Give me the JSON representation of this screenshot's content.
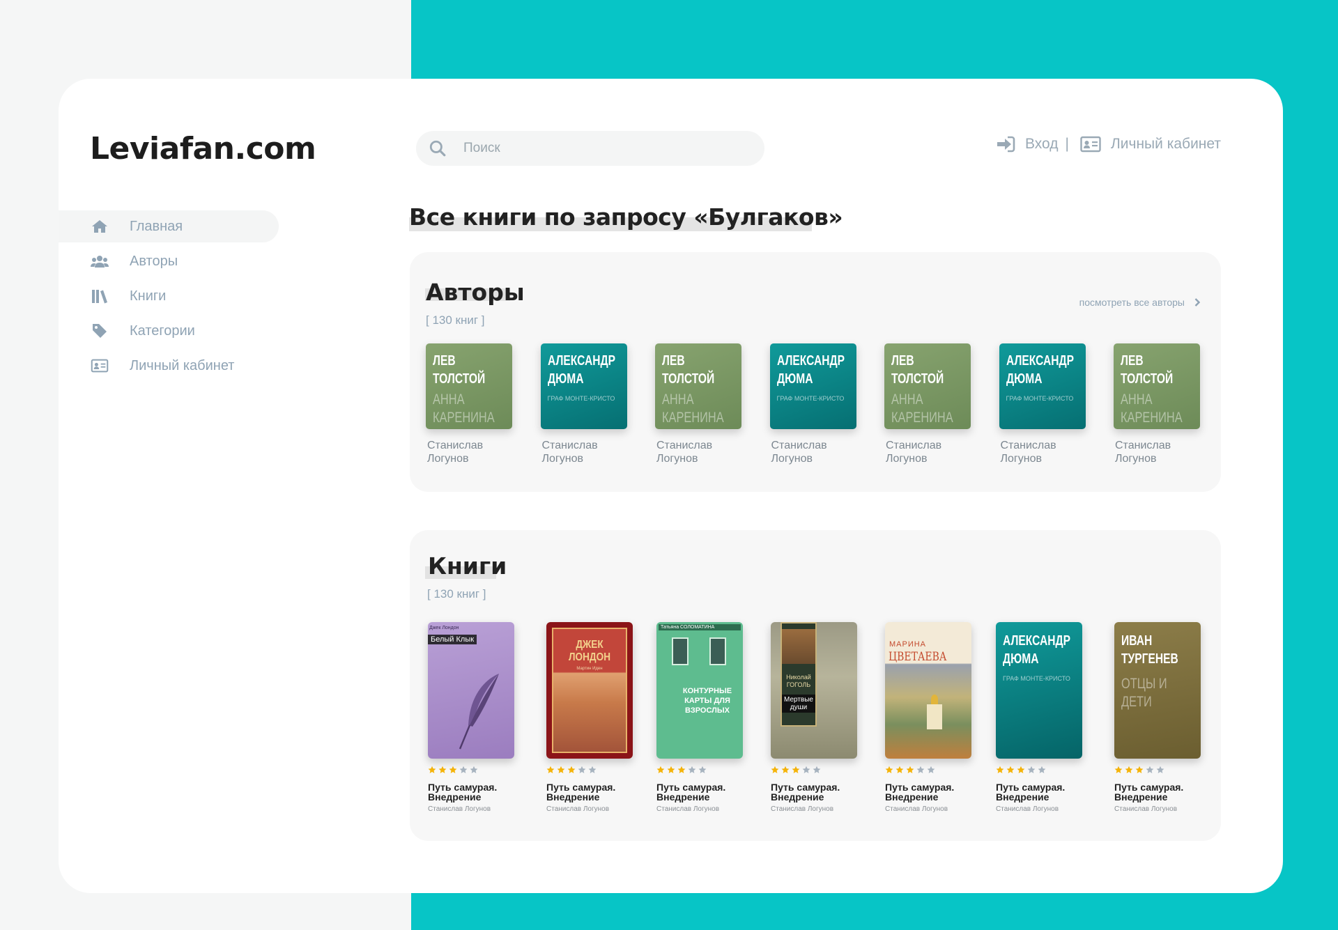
{
  "site": {
    "logo": "Leviafan.com"
  },
  "search": {
    "placeholder": "Поиск"
  },
  "topnav": {
    "login": "Вход",
    "separator": "|",
    "cabinet": "Личный кабинет"
  },
  "sidebar": {
    "items": [
      {
        "label": "Главная",
        "icon": "home-icon",
        "active": true
      },
      {
        "label": "Авторы",
        "icon": "users-icon"
      },
      {
        "label": "Книги",
        "icon": "books-icon"
      },
      {
        "label": "Категории",
        "icon": "tag-icon"
      },
      {
        "label": "Личный кабинет",
        "icon": "id-card-icon"
      }
    ]
  },
  "page": {
    "heading": "Все книги по запросу «Булгаков»"
  },
  "authors_section": {
    "title": "Авторы",
    "count": "[ 130 книг ]",
    "see_all": "посмотреть все авторы",
    "cards": [
      {
        "cover_author": "Лев Толстой",
        "cover_title": "Анна Каренина",
        "cover_sub": "",
        "color": "green",
        "name": "Станислав Логунов"
      },
      {
        "cover_author": "Александр Дюма",
        "cover_title": "",
        "cover_sub": "Граф Монте-Кристо",
        "color": "teal",
        "name": "Станислав Логунов"
      },
      {
        "cover_author": "Лев Толстой",
        "cover_title": "Анна Каренина",
        "cover_sub": "",
        "color": "green",
        "name": "Станислав Логунов"
      },
      {
        "cover_author": "Александр Дюма",
        "cover_title": "",
        "cover_sub": "Граф Монте-Кристо",
        "color": "teal",
        "name": "Станислав Логунов"
      },
      {
        "cover_author": "Лев Толстой",
        "cover_title": "Анна Каренина",
        "cover_sub": "",
        "color": "green",
        "name": "Станислав Логунов"
      },
      {
        "cover_author": "Александр Дюма",
        "cover_title": "",
        "cover_sub": "Граф Монте-Кристо",
        "color": "teal",
        "name": "Станислав Логунов"
      },
      {
        "cover_author": "Лев Толстой",
        "cover_title": "Анна Каренина",
        "cover_sub": "",
        "color": "green",
        "name": "Станислав Логунов"
      }
    ]
  },
  "books_section": {
    "title": "Книги",
    "count": "[ 130 книг ]",
    "cards": [
      {
        "cover_top": "Джек Лондон",
        "cover_label": "Белый Клык",
        "rating": 3,
        "title": "Путь самурая. Внедрение",
        "author": "Станислав Логунов"
      },
      {
        "cover_top": "ДЖЕК ЛОНДОН",
        "cover_label": "Мартин Иден",
        "rating": 3,
        "title": "Путь самурая. Внедрение",
        "author": "Станислав Логунов"
      },
      {
        "cover_top": "Татьяна СОЛОМАТИНА",
        "cover_label": "КОНТУРНЫЕ КАРТЫ ДЛЯ ВЗРОСЛЫХ",
        "rating": 3,
        "title": "Путь самурая. Внедрение",
        "author": "Станислав Логунов"
      },
      {
        "cover_top": "Николай ГОГОЛЬ",
        "cover_label": "Мертвые души",
        "rating": 3,
        "title": "Путь самурая. Внедрение",
        "author": "Станислав Логунов"
      },
      {
        "cover_top": "МАРИНА",
        "cover_label": "ЦВЕТАЕВА",
        "rating": 3,
        "title": "Путь самурая. Внедрение",
        "author": "Станислав Логунов"
      },
      {
        "cover_top": "Александр Дюма",
        "cover_label": "Граф Монте-Кристо",
        "rating": 3,
        "title": "Путь самурая. Внедрение",
        "author": "Станислав Логунов"
      },
      {
        "cover_top": "Иван Тургенев",
        "cover_label": "Отцы и дети",
        "rating": 3,
        "title": "Путь самурая. Внедрение",
        "author": "Станислав Логунов"
      }
    ]
  },
  "colors": {
    "teal": "#07c5c6",
    "star_on": "#f5b40a",
    "star_off": "#a8b4c0",
    "muted": "#8fa3b4"
  }
}
